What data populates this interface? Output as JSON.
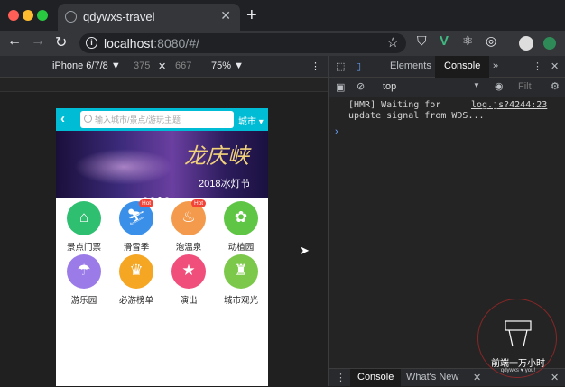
{
  "browser": {
    "tab_title": "qdywxs-travel",
    "url_host": "localhost",
    "url_rest": ":8080/#/",
    "new_tab": "+",
    "tab_close": "✕"
  },
  "device_toolbar": {
    "device": "iPhone 6/7/8 ▼",
    "width": "375",
    "times": "✕",
    "height": "667",
    "zoom": "75% ▼"
  },
  "app": {
    "search_placeholder": "输入城市/景点/游玩主题",
    "city": "城市 ▾",
    "banner_title": "龙庆峡",
    "banner_subtitle": "2018冰灯节",
    "icons": [
      {
        "label": "景点门票",
        "color": "#2fbf71",
        "glyph": "⌂",
        "hot": ""
      },
      {
        "label": "滑雪季",
        "color": "#3a8fe8",
        "glyph": "⛷",
        "hot": "Hot"
      },
      {
        "label": "泡温泉",
        "color": "#f39a4c",
        "glyph": "♨",
        "hot": "Hot"
      },
      {
        "label": "动植园",
        "color": "#5ec545",
        "glyph": "✿",
        "hot": ""
      },
      {
        "label": "游乐园",
        "color": "#9b7be8",
        "glyph": "☂",
        "hot": ""
      },
      {
        "label": "必游榜单",
        "color": "#f5a623",
        "glyph": "♛",
        "hot": ""
      },
      {
        "label": "演出",
        "color": "#ef4f7a",
        "glyph": "★",
        "hot": ""
      },
      {
        "label": "城市观光",
        "color": "#7cc84a",
        "glyph": "♜",
        "hot": ""
      }
    ]
  },
  "devtools": {
    "tab_elements": "Elements",
    "tab_console": "Console",
    "context": "top",
    "filter_placeholder": "Filt",
    "console_message": "[HMR] Waiting for\nupdate signal from WDS...",
    "console_source": "log.js?4244:23",
    "bottom_console": "Console",
    "bottom_whats_new": "What's New"
  },
  "watermark": {
    "title": "前端一万小时",
    "subtitle": "qdywxs ♥ you!"
  }
}
